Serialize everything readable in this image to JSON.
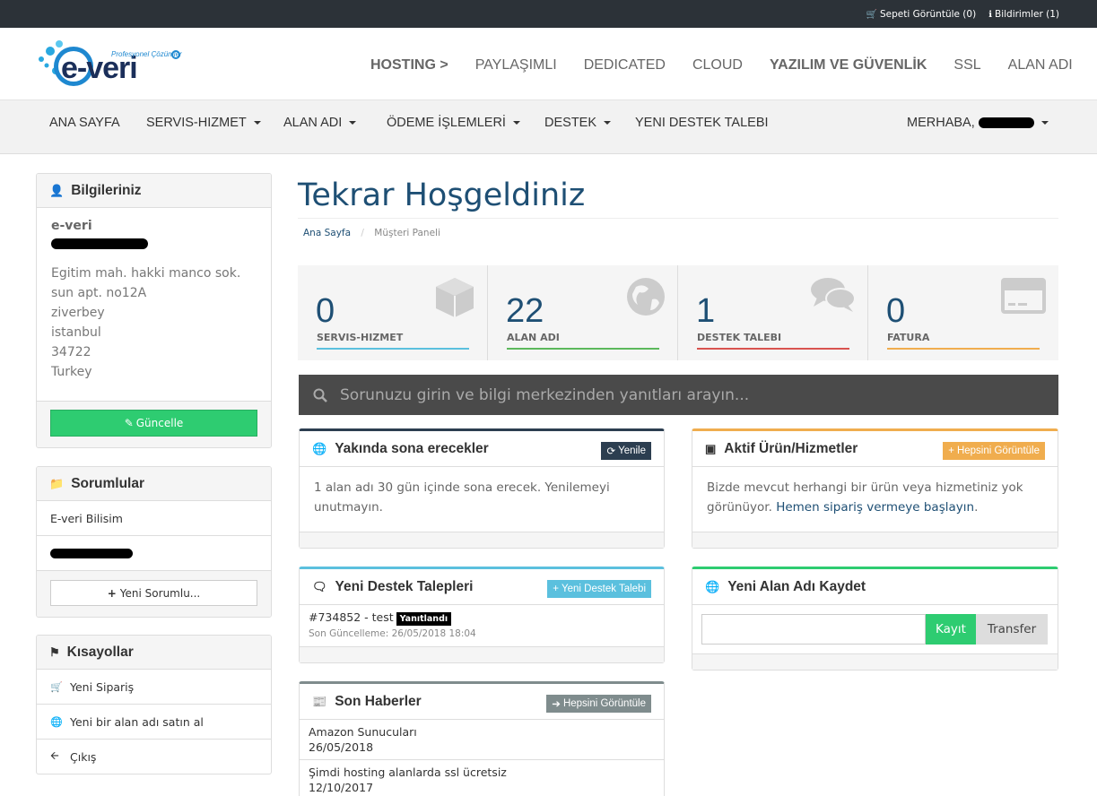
{
  "topbar": {
    "cart": "Sepeti Görüntüle (0)",
    "notifications": "Bildirimler (1)"
  },
  "logo": {
    "brand": "e-veri",
    "tagline": "Profesyonel Çözümler"
  },
  "main_nav": [
    "HOSTING >",
    "PAYLAŞIMLI",
    "DEDICATED",
    "CLOUD",
    "YAZILIM VE GÜVENLİK",
    "SSL",
    "ALAN ADI"
  ],
  "sub_nav": {
    "home": "ANA SAYFA",
    "services": "SERVIS-HIZMET",
    "domains": "ALAN ADI",
    "payments": "ÖDEME İŞLEMLERİ",
    "support": "DESTEK",
    "new_ticket": "YENI DESTEK TALEBI",
    "greeting": "MERHABA,"
  },
  "info_panel": {
    "title": "Bilgileriniz",
    "company": "e-veri",
    "address": [
      "Egitim mah. hakki manco sok. sun apt. no12A",
      "ziverbey",
      "istanbul",
      "34722",
      "Turkey"
    ],
    "update_btn": "Güncelle"
  },
  "contacts_panel": {
    "title": "Sorumlular",
    "item": "E-veri Bilisim",
    "add_btn": "Yeni Sorumlu..."
  },
  "shortcuts_panel": {
    "title": "Kısayollar",
    "items": [
      "Yeni Sipariş",
      "Yeni bir alan adı satın al",
      "Çıkış"
    ]
  },
  "page": {
    "title": "Tekrar Hoşgeldiniz",
    "breadcrumb_home": "Ana Sayfa",
    "breadcrumb_sep": "/",
    "breadcrumb_current": "Müşteri Paneli"
  },
  "stats": [
    {
      "value": "0",
      "label": "SERVIS-HIZMET",
      "color": "#5bc0de"
    },
    {
      "value": "22",
      "label": "ALAN ADI",
      "color": "#5cb85c"
    },
    {
      "value": "1",
      "label": "DESTEK TALEBI",
      "color": "#d9534f"
    },
    {
      "value": "0",
      "label": "FATURA",
      "color": "#f0ad4e"
    }
  ],
  "search": {
    "placeholder": "Sorunuzu girin ve bilgi merkezinden yanıtları arayın..."
  },
  "expiring": {
    "title": "Yakında sona erecekler",
    "btn": "Yenile",
    "text": "1 alan adı 30 gün içinde sona erecek. Yenilemeyi unutmayın."
  },
  "active_products": {
    "title": "Aktif Ürün/Hizmetler",
    "btn": "Hepsini Görüntüle",
    "text": "Bizde mevcut herhangi bir ürün veya hizmetiniz yok görünüyor.",
    "link": "Hemen sipariş vermeye başlayın",
    "period": "."
  },
  "tickets": {
    "title": "Yeni Destek Talepleri",
    "btn": "Yeni Destek Talebi",
    "ticket": "#734852 - test",
    "status": "Yanıtlandı",
    "updated": "Son Güncelleme: 26/05/2018 18:04"
  },
  "domain_register": {
    "title": "Yeni Alan Adı Kaydet",
    "register_btn": "Kayıt",
    "transfer_btn": "Transfer"
  },
  "news": {
    "title": "Son Haberler",
    "btn": "Hepsini Görüntüle",
    "items": [
      {
        "title": "Amazon Sunucuları",
        "date": "26/05/2018"
      },
      {
        "title": "Şimdi hosting alanlarda ssl ücretsiz",
        "date": "12/10/2017"
      }
    ]
  },
  "colors": {
    "topbar": "#2c3238",
    "primary": "#1e4f74",
    "green": "#2ecc71",
    "orange": "#f0ad4e",
    "info": "#5bc0de",
    "gray": "#7f8c8d"
  }
}
